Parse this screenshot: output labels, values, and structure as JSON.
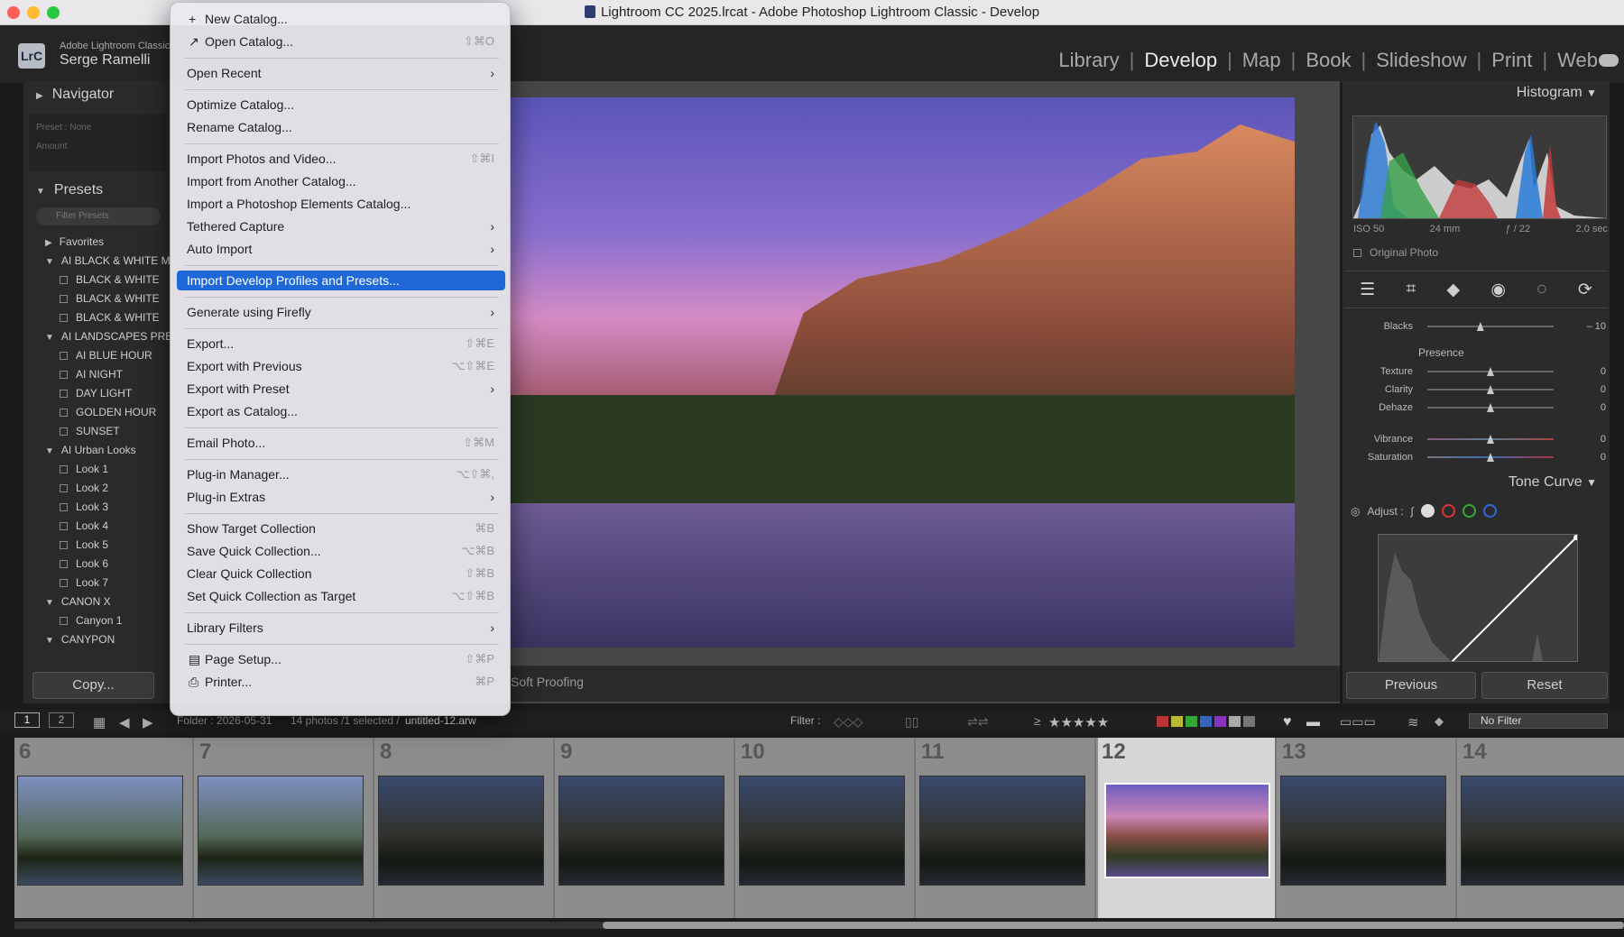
{
  "window": {
    "title": "Lightroom CC 2025.lrcat - Adobe Photoshop Lightroom Classic - Develop"
  },
  "identity": {
    "logo": "LrC",
    "app": "Adobe Lightroom Classic",
    "user": "Serge Ramelli"
  },
  "modules": [
    "Library",
    "Develop",
    "Map",
    "Book",
    "Slideshow",
    "Print",
    "Web"
  ],
  "active_module": "Develop",
  "left_panel": {
    "navigator": "Navigator",
    "preset_none": "Preset : None",
    "amount": "Amount",
    "presets_title": "Presets",
    "filter_placeholder": "Filter Presets",
    "items": [
      {
        "label": "Favorites",
        "type": "group"
      },
      {
        "label": "AI BLACK & WHITE M",
        "type": "group"
      },
      {
        "label": "BLACK & WHITE",
        "type": "item"
      },
      {
        "label": "BLACK & WHITE",
        "type": "item"
      },
      {
        "label": "BLACK & WHITE",
        "type": "item"
      },
      {
        "label": "AI LANDSCAPES PRE",
        "type": "group"
      },
      {
        "label": "AI BLUE HOUR",
        "type": "item"
      },
      {
        "label": "AI NIGHT",
        "type": "item"
      },
      {
        "label": "DAY LIGHT",
        "type": "item"
      },
      {
        "label": "GOLDEN HOUR",
        "type": "item"
      },
      {
        "label": "SUNSET",
        "type": "item"
      },
      {
        "label": "AI Urban Looks",
        "type": "group"
      },
      {
        "label": "Look 1",
        "type": "item"
      },
      {
        "label": "Look 2",
        "type": "item"
      },
      {
        "label": "Look 3",
        "type": "item"
      },
      {
        "label": "Look 4",
        "type": "item"
      },
      {
        "label": "Look 5",
        "type": "item"
      },
      {
        "label": "Look 6",
        "type": "item"
      },
      {
        "label": "Look 7",
        "type": "item"
      },
      {
        "label": "CANON X",
        "type": "group"
      },
      {
        "label": "Canyon 1",
        "type": "item"
      },
      {
        "label": "CANYPON",
        "type": "group"
      }
    ],
    "copy_button": "Copy..."
  },
  "center": {
    "soft_proofing": "Soft Proofing"
  },
  "menu": {
    "items": [
      {
        "label": "New Catalog...",
        "icon": "+",
        "shortcut": ""
      },
      {
        "label": "Open Catalog...",
        "icon": "↗",
        "shortcut": "⇧⌘O"
      },
      {
        "sep": true
      },
      {
        "label": "Open Recent",
        "submenu": true
      },
      {
        "sep": true
      },
      {
        "label": "Optimize Catalog...",
        "shortcut": ""
      },
      {
        "label": "Rename Catalog...",
        "shortcut": ""
      },
      {
        "sep": true
      },
      {
        "label": "Import Photos and Video...",
        "shortcut": "⇧⌘I"
      },
      {
        "label": "Import from Another Catalog...",
        "shortcut": ""
      },
      {
        "label": "Import a Photoshop Elements Catalog...",
        "shortcut": ""
      },
      {
        "label": "Tethered Capture",
        "submenu": true
      },
      {
        "label": "Auto Import",
        "submenu": true
      },
      {
        "sep": true
      },
      {
        "label": "Import Develop Profiles and Presets...",
        "highlighted": true
      },
      {
        "sep": true
      },
      {
        "label": "Generate using Firefly",
        "submenu": true
      },
      {
        "sep": true
      },
      {
        "label": "Export...",
        "shortcut": "⇧⌘E"
      },
      {
        "label": "Export with Previous",
        "shortcut": "⌥⇧⌘E"
      },
      {
        "label": "Export with Preset",
        "submenu": true
      },
      {
        "label": "Export as Catalog...",
        "shortcut": ""
      },
      {
        "sep": true
      },
      {
        "label": "Email Photo...",
        "shortcut": "⇧⌘M"
      },
      {
        "sep": true
      },
      {
        "label": "Plug-in Manager...",
        "shortcut": "⌥⇧⌘,"
      },
      {
        "label": "Plug-in Extras",
        "submenu": true
      },
      {
        "sep": true
      },
      {
        "label": "Show Target Collection",
        "shortcut": "⌘B"
      },
      {
        "label": "Save Quick Collection...",
        "shortcut": "⌥⌘B"
      },
      {
        "label": "Clear Quick Collection",
        "shortcut": "⇧⌘B"
      },
      {
        "label": "Set Quick Collection as Target",
        "shortcut": "⌥⇧⌘B"
      },
      {
        "sep": true
      },
      {
        "label": "Library Filters",
        "submenu": true
      },
      {
        "sep": true
      },
      {
        "label": "Page Setup...",
        "icon": "▤",
        "shortcut": "⇧⌘P"
      },
      {
        "label": "Printer...",
        "icon": "⎙",
        "shortcut": "⌘P"
      }
    ]
  },
  "right_panel": {
    "histogram": "Histogram",
    "iso": "ISO 50",
    "focal": "24 mm",
    "aperture": "ƒ / 22",
    "shutter": "2.0 sec",
    "original_photo": "Original Photo",
    "blacks": {
      "label": "Blacks",
      "value": "– 10",
      "level": 0.42
    },
    "presence_title": "Presence",
    "presence": [
      {
        "label": "Texture",
        "value": "0",
        "level": 0.5
      },
      {
        "label": "Clarity",
        "value": "0",
        "level": 0.5
      },
      {
        "label": "Dehaze",
        "value": "0",
        "level": 0.5
      },
      {
        "label": "Vibrance",
        "value": "0",
        "level": 0.5
      },
      {
        "label": "Saturation",
        "value": "0",
        "level": 0.5
      }
    ],
    "tone_curve": "Tone Curve",
    "adjust": "Adjust :",
    "previous": "Previous",
    "reset": "Reset"
  },
  "filmstrip_bar": {
    "view1": "1",
    "view2": "2",
    "folder": "Folder : 2026-05-31",
    "count": "14 photos /1 selected /",
    "filename": "untitled-12.arw",
    "filter_label": "Filter :",
    "rating_op": "≥",
    "stars": "★★★★★",
    "no_filter": "No Filter"
  },
  "filmstrip": [
    {
      "num": "6",
      "tone": "lt"
    },
    {
      "num": "7",
      "tone": "lt"
    },
    {
      "num": "8",
      "tone": "dk"
    },
    {
      "num": "9",
      "tone": "dk"
    },
    {
      "num": "10",
      "tone": "dk"
    },
    {
      "num": "11",
      "tone": "dk"
    },
    {
      "num": "12",
      "tone": "pk",
      "selected": true
    },
    {
      "num": "13",
      "tone": "dk"
    },
    {
      "num": "14",
      "tone": "dk"
    }
  ],
  "colors": {
    "accent": "#1f68d8",
    "panel": "#2b2b2b",
    "menu_bg": "#ece8f0"
  }
}
